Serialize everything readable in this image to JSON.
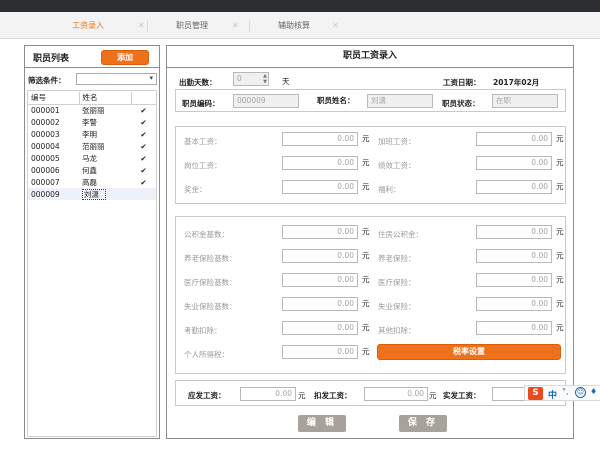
{
  "tabs": [
    {
      "label": "工资录入",
      "active": true
    },
    {
      "label": "职员管理",
      "active": false
    },
    {
      "label": "辅助核算",
      "active": false
    }
  ],
  "left_panel": {
    "title": "职员列表",
    "add_button": "添加",
    "filter_label": "筛选条件：",
    "filter_value": "",
    "columns": [
      "编号",
      "姓名",
      ""
    ],
    "employees": [
      {
        "id": "000001",
        "name": "张丽丽",
        "check": "✔"
      },
      {
        "id": "000002",
        "name": "李警",
        "check": "✔"
      },
      {
        "id": "000003",
        "name": "李明",
        "check": "✔"
      },
      {
        "id": "000004",
        "name": "范丽丽",
        "check": "✔"
      },
      {
        "id": "000005",
        "name": "马龙",
        "check": "✔"
      },
      {
        "id": "000006",
        "name": "何鑫",
        "check": "✔"
      },
      {
        "id": "000007",
        "name": "高磊",
        "check": "✔"
      },
      {
        "id": "000009",
        "name": "刘潇",
        "check": ""
      }
    ]
  },
  "right_panel": {
    "title": "职员工资录入",
    "attendance_label": "出勤天数：",
    "attendance_value": "0",
    "attendance_unit": "天",
    "pay_date_label": "工资日期：",
    "pay_date_value": "2017年02月",
    "emp_code_label": "职员编码：",
    "emp_code_value": "000009",
    "emp_name_label": "职员姓名：",
    "emp_name_value": "刘潇",
    "emp_status_label": "职员状态：",
    "emp_status_value": "在职",
    "currency_unit": "元",
    "salary_fields": [
      {
        "label": "基本工资：",
        "value": "0.00"
      },
      {
        "label": "加班工资：",
        "value": "0.00"
      },
      {
        "label": "岗位工资：",
        "value": "0.00"
      },
      {
        "label": "绩效工资：",
        "value": "0.00"
      },
      {
        "label": "奖金：",
        "value": "0.00"
      },
      {
        "label": "福利：",
        "value": "0.00"
      }
    ],
    "deduction_fields": [
      {
        "label": "公积金基数：",
        "value": "0.00"
      },
      {
        "label": "住房公积金：",
        "value": "0.00"
      },
      {
        "label": "养老保险基数：",
        "value": "0.00"
      },
      {
        "label": "养老保险：",
        "value": "0.00"
      },
      {
        "label": "医疗保险基数：",
        "value": "0.00"
      },
      {
        "label": "医疗保险：",
        "value": "0.00"
      },
      {
        "label": "失业保险基数：",
        "value": "0.00"
      },
      {
        "label": "失业保险：",
        "value": "0.00"
      },
      {
        "label": "考勤扣除：",
        "value": "0.00"
      },
      {
        "label": "其他扣除：",
        "value": "0.00"
      },
      {
        "label": "个人所得税：",
        "value": "0.00"
      }
    ],
    "tax_button": "税率设置",
    "totals": {
      "payable_label": "应发工资：",
      "payable_value": "0.00",
      "deducted_label": "扣发工资：",
      "deducted_value": "0.00",
      "actual_label": "实发工资：",
      "actual_value": ""
    },
    "edit_button": "编 辑",
    "save_button": "保 存"
  },
  "ime_bar": {
    "logo": "S",
    "mode": "中"
  },
  "colors": {
    "accent": "#f0711b",
    "active_tab": "#e8781e",
    "gray_button": "#a8a29a"
  }
}
